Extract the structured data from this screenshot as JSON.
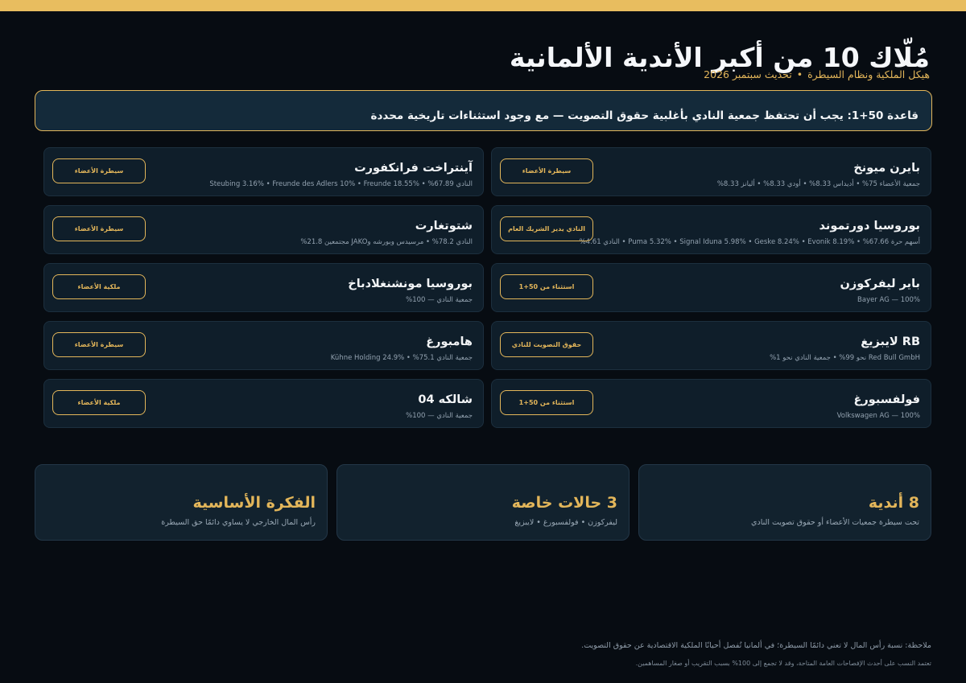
{
  "header": {
    "title": "مُلّاك 10 من أكبر الأندية الألمانية",
    "subtitle_left": "هيكل الملكية ونظام السيطرة",
    "subtitle_sep": "•",
    "subtitle_right": "تحديث سبتمبر 2026"
  },
  "rule_banner": "قاعدة 50+1: يجب أن تحتفظ جمعية النادي بأغلبية حقوق التصويت — مع وجود استثناءات تاريخية محددة",
  "clubs": [
    {
      "name": "بايرن ميونخ",
      "detail": "جمعية الأعضاء 75% • أديداس 8.33% • أودي 8.33% • أليانز 8.33%",
      "badge": "سيطرة الأعضاء"
    },
    {
      "name": "آينتراخت فرانكفورت",
      "detail": "النادي 67.89% • Steubing 3.16% • Freunde des Adlers 10% • Freunde 18.55%",
      "badge": "سيطرة الأعضاء"
    },
    {
      "name": "بوروسيا دورتموند",
      "detail": "أسهم حرة 67.66% • Puma 5.32% • Signal Iduna 5.98% • Geske 8.24% • Evonik 8.19% • النادي 4.61%",
      "badge": "النادي يدير الشريك العام"
    },
    {
      "name": "شتوتغارت",
      "detail": "النادي 78.2% • مرسيدس وبورشه وJAKO مجتمعين 21.8%",
      "badge": "سيطرة الأعضاء"
    },
    {
      "name": "باير ليفركوزن",
      "detail": "Bayer AG — 100%",
      "badge": "استثناء من 50+1"
    },
    {
      "name": "بوروسيا مونشنغلادباخ",
      "detail": "جمعية النادي — 100%",
      "badge": "ملكية الأعضاء"
    },
    {
      "name": "RB لايبزيغ",
      "detail": "Red Bull GmbH نحو 99% • جمعية النادي نحو 1%",
      "badge": "حقوق التصويت للنادي"
    },
    {
      "name": "هامبورغ",
      "detail": "جمعية النادي 75.1% • Kühne Holding 24.9%",
      "badge": "سيطرة الأعضاء"
    },
    {
      "name": "فولفسبورغ",
      "detail": "Volkswagen AG — 100%",
      "badge": "استثناء من 50+1"
    },
    {
      "name": "شالكه 04",
      "detail": "جمعية النادي — 100%",
      "badge": "ملكية الأعضاء"
    }
  ],
  "stats": [
    {
      "big": "8 أندية",
      "small": "تحت سيطرة جمعيات الأعضاء أو حقوق تصويت النادي"
    },
    {
      "big": "3 حالات خاصة",
      "small": "ليفركوزن • فولفسبورغ • لايبزيغ"
    },
    {
      "big": "الفكرة الأساسية",
      "small": "رأس المال الخارجي لا يساوي دائمًا حق السيطرة"
    }
  ],
  "footer": {
    "note": "ملاحظة: نسبة رأس المال لا تعني دائمًا السيطرة؛ في ألمانيا تُفصل أحيانًا الملكية الاقتصادية عن حقوق التصويت.",
    "source": "تعتمد النسب على أحدث الإفصاحات العامة المتاحة، وقد لا تجمع إلى 100% بسبب التقريب أو صغار المساهمين."
  },
  "colors": {
    "accent": "#e3b65a",
    "background": "#070c12",
    "card": "#0f1e2a"
  }
}
